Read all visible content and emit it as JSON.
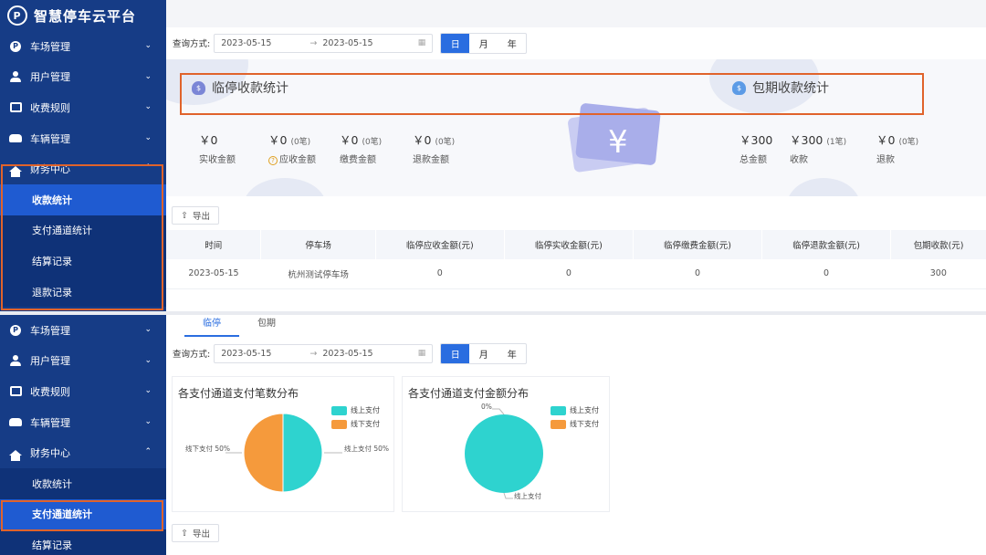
{
  "app": {
    "title": "智慧停车云平台",
    "logo_icon": "parking-cloud-logo"
  },
  "colors": {
    "sidebar_bg": "#163c86",
    "active_item": "#1f5bd1",
    "highlight": "#e0632b",
    "accent": "#2a6de0",
    "pie_online": "#2ed3cf",
    "pie_offline": "#f59a3c"
  },
  "top": {
    "menu": [
      {
        "label": "车场管理",
        "icon": "parking-icon"
      },
      {
        "label": "用户管理",
        "icon": "user-icon"
      },
      {
        "label": "收费规则",
        "icon": "wallet-icon"
      },
      {
        "label": "车辆管理",
        "icon": "car-icon"
      },
      {
        "label": "财务中心",
        "icon": "home-icon",
        "expanded": true
      }
    ],
    "submenu": [
      {
        "label": "收款统计",
        "active": true
      },
      {
        "label": "支付通道统计"
      },
      {
        "label": "结算记录"
      },
      {
        "label": "退款记录"
      }
    ],
    "query": {
      "label": "查询方式:",
      "start": "2023-05-15",
      "end": "2023-05-15",
      "sep": "→",
      "granularity": [
        "日",
        "月",
        "年"
      ],
      "selected": "日"
    },
    "temp_panel": {
      "title": "临停收款统计",
      "stats": [
        {
          "value": "￥0",
          "count": "",
          "label": "实收金额"
        },
        {
          "value": "￥0",
          "count": "(0笔)",
          "label": "应收金额",
          "help": "?"
        },
        {
          "value": "￥0",
          "count": "(0笔)",
          "label": "缴费金额"
        },
        {
          "value": "￥0",
          "count": "(0笔)",
          "label": "退款金额"
        }
      ]
    },
    "period_panel": {
      "title": "包期收款统计",
      "stats": [
        {
          "value": "￥300",
          "count": "",
          "label": "总金额"
        },
        {
          "value": "￥300",
          "count": "(1笔)",
          "label": "收款"
        },
        {
          "value": "￥0",
          "count": "(0笔)",
          "label": "退款"
        }
      ]
    },
    "export_label": "导出",
    "table": {
      "headers": [
        "时间",
        "停车场",
        "临停应收金额(元)",
        "临停实收金额(元)",
        "临停缴费金额(元)",
        "临停退款金额(元)",
        "包期收款(元)"
      ],
      "rows": [
        [
          "2023-05-15",
          "杭州测试停车场",
          "0",
          "0",
          "0",
          "0",
          "300"
        ]
      ]
    }
  },
  "bottom": {
    "menu": [
      {
        "label": "车场管理",
        "icon": "parking-icon"
      },
      {
        "label": "用户管理",
        "icon": "user-icon"
      },
      {
        "label": "收费规则",
        "icon": "wallet-icon"
      },
      {
        "label": "车辆管理",
        "icon": "car-icon"
      },
      {
        "label": "财务中心",
        "icon": "home-icon",
        "expanded": true
      }
    ],
    "submenu": [
      {
        "label": "收款统计"
      },
      {
        "label": "支付通道统计",
        "active": true
      },
      {
        "label": "结算记录"
      }
    ],
    "tabs": [
      {
        "label": "临停",
        "active": true
      },
      {
        "label": "包期"
      }
    ],
    "query": {
      "label": "查询方式:",
      "start": "2023-05-15",
      "end": "2023-05-15",
      "sep": "→",
      "granularity": [
        "日",
        "月",
        "年"
      ],
      "selected": "日"
    },
    "export_label": "导出"
  },
  "chart_data": [
    {
      "type": "pie",
      "title": "各支付通道支付笔数分布",
      "categories": [
        "线上支付",
        "线下支付"
      ],
      "values": [
        50,
        50
      ],
      "labels": [
        "线上支付 50%",
        "线下支付 50%"
      ],
      "legend": [
        "线上支付",
        "线下支付"
      ],
      "legend_position": "top-right"
    },
    {
      "type": "pie",
      "title": "各支付通道支付金额分布",
      "categories": [
        "线上支付",
        "线下支付"
      ],
      "values": [
        100,
        0
      ],
      "labels": [
        "线上支付",
        "0%"
      ],
      "legend": [
        "线上支付",
        "线下支付"
      ],
      "legend_position": "top-right"
    }
  ]
}
